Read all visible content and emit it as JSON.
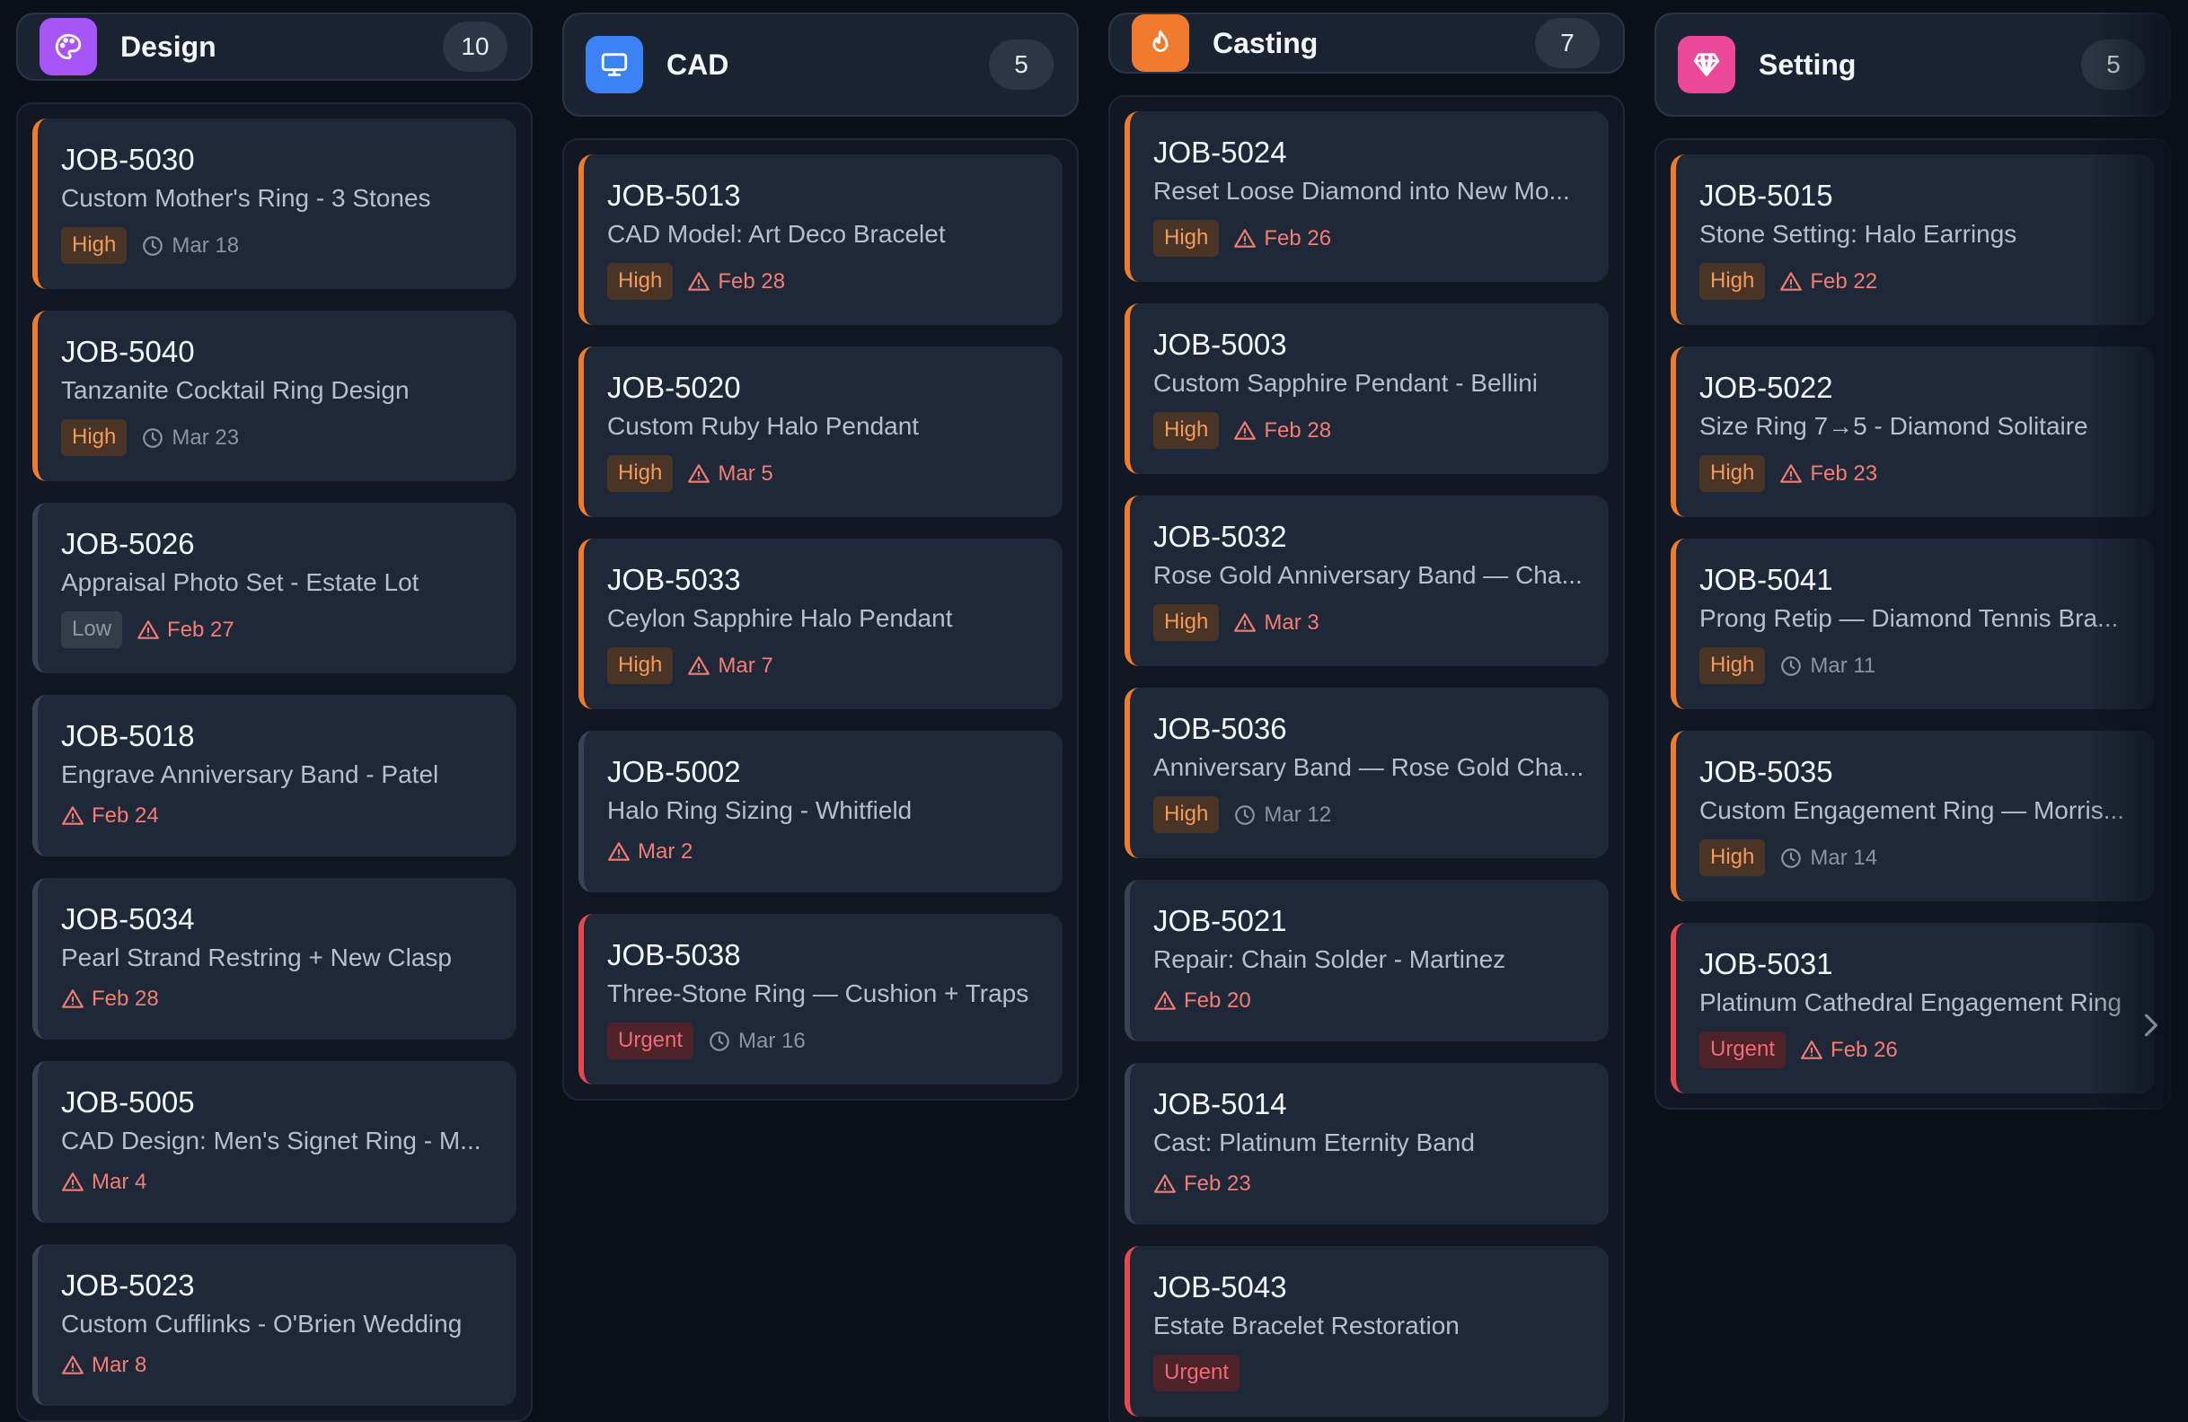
{
  "colors": {
    "design": "#a855f7",
    "cad": "#3b82f6",
    "casting": "#f07b2e",
    "setting": "#ec4899",
    "high": "#f07b2e",
    "urgent": "#e5484d"
  },
  "columns": [
    {
      "key": "design",
      "title": "Design",
      "count": "10",
      "icon": "palette-icon",
      "cards": [
        {
          "id": "JOB-5030",
          "title": "Custom Mother's Ring - 3 Stones",
          "priority": "High",
          "due": "Mar 18",
          "due_icon": "clock-icon"
        },
        {
          "id": "JOB-5040",
          "title": "Tanzanite Cocktail Ring Design",
          "priority": "High",
          "due": "Mar 23",
          "due_icon": "clock-icon"
        },
        {
          "id": "JOB-5026",
          "title": "Appraisal Photo Set - Estate Lot",
          "priority": "Low",
          "due": "Feb 27",
          "due_icon": "warning-icon"
        },
        {
          "id": "JOB-5018",
          "title": "Engrave Anniversary Band - Patel",
          "priority": "",
          "due": "Feb 24",
          "due_icon": "warning-icon"
        },
        {
          "id": "JOB-5034",
          "title": "Pearl Strand Restring + New Clasp",
          "priority": "",
          "due": "Feb 28",
          "due_icon": "warning-icon"
        },
        {
          "id": "JOB-5005",
          "title": "CAD Design: Men's Signet Ring - M...",
          "priority": "",
          "due": "Mar 4",
          "due_icon": "warning-icon"
        },
        {
          "id": "JOB-5023",
          "title": "Custom Cufflinks - O'Brien Wedding",
          "priority": "",
          "due": "Mar 8",
          "due_icon": "warning-icon"
        }
      ]
    },
    {
      "key": "cad",
      "title": "CAD",
      "count": "5",
      "icon": "monitor-icon",
      "cards": [
        {
          "id": "JOB-5013",
          "title": "CAD Model: Art Deco Bracelet",
          "priority": "High",
          "due": "Feb 28",
          "due_icon": "warning-icon"
        },
        {
          "id": "JOB-5020",
          "title": "Custom Ruby Halo Pendant",
          "priority": "High",
          "due": "Mar 5",
          "due_icon": "warning-icon"
        },
        {
          "id": "JOB-5033",
          "title": "Ceylon Sapphire Halo Pendant",
          "priority": "High",
          "due": "Mar 7",
          "due_icon": "warning-icon"
        },
        {
          "id": "JOB-5002",
          "title": "Halo Ring Sizing - Whitfield",
          "priority": "",
          "due": "Mar 2",
          "due_icon": "warning-icon"
        },
        {
          "id": "JOB-5038",
          "title": "Three-Stone Ring — Cushion + Traps",
          "priority": "Urgent",
          "due": "Mar 16",
          "due_icon": "clock-icon"
        }
      ]
    },
    {
      "key": "casting",
      "title": "Casting",
      "count": "7",
      "icon": "flame-icon",
      "cards": [
        {
          "id": "JOB-5024",
          "title": "Reset Loose Diamond into New Mo...",
          "priority": "High",
          "due": "Feb 26",
          "due_icon": "warning-icon"
        },
        {
          "id": "JOB-5003",
          "title": "Custom Sapphire Pendant - Bellini",
          "priority": "High",
          "due": "Feb 28",
          "due_icon": "warning-icon"
        },
        {
          "id": "JOB-5032",
          "title": "Rose Gold Anniversary Band — Cha...",
          "priority": "High",
          "due": "Mar 3",
          "due_icon": "warning-icon"
        },
        {
          "id": "JOB-5036",
          "title": "Anniversary Band — Rose Gold Cha...",
          "priority": "High",
          "due": "Mar 12",
          "due_icon": "clock-icon"
        },
        {
          "id": "JOB-5021",
          "title": "Repair: Chain Solder - Martinez",
          "priority": "",
          "due": "Feb 20",
          "due_icon": "warning-icon"
        },
        {
          "id": "JOB-5014",
          "title": "Cast: Platinum Eternity Band",
          "priority": "",
          "due": "Feb 23",
          "due_icon": "warning-icon"
        },
        {
          "id": "JOB-5043",
          "title": "Estate Bracelet Restoration",
          "priority": "Urgent",
          "due": "",
          "due_icon": "warning-icon"
        }
      ]
    },
    {
      "key": "setting",
      "title": "Setting",
      "count": "5",
      "icon": "gem-icon",
      "cards": [
        {
          "id": "JOB-5015",
          "title": "Stone Setting: Halo Earrings",
          "priority": "High",
          "due": "Feb 22",
          "due_icon": "warning-icon"
        },
        {
          "id": "JOB-5022",
          "title": "Size Ring 7→5 - Diamond Solitaire",
          "priority": "High",
          "due": "Feb 23",
          "due_icon": "warning-icon"
        },
        {
          "id": "JOB-5041",
          "title": "Prong Retip — Diamond Tennis Bra...",
          "priority": "High",
          "due": "Mar 11",
          "due_icon": "clock-icon"
        },
        {
          "id": "JOB-5035",
          "title": "Custom Engagement Ring — Morris...",
          "priority": "High",
          "due": "Mar 14",
          "due_icon": "clock-icon"
        },
        {
          "id": "JOB-5031",
          "title": "Platinum Cathedral Engagement Ring",
          "priority": "Urgent",
          "due": "Feb 26",
          "due_icon": "warning-icon"
        }
      ]
    }
  ]
}
